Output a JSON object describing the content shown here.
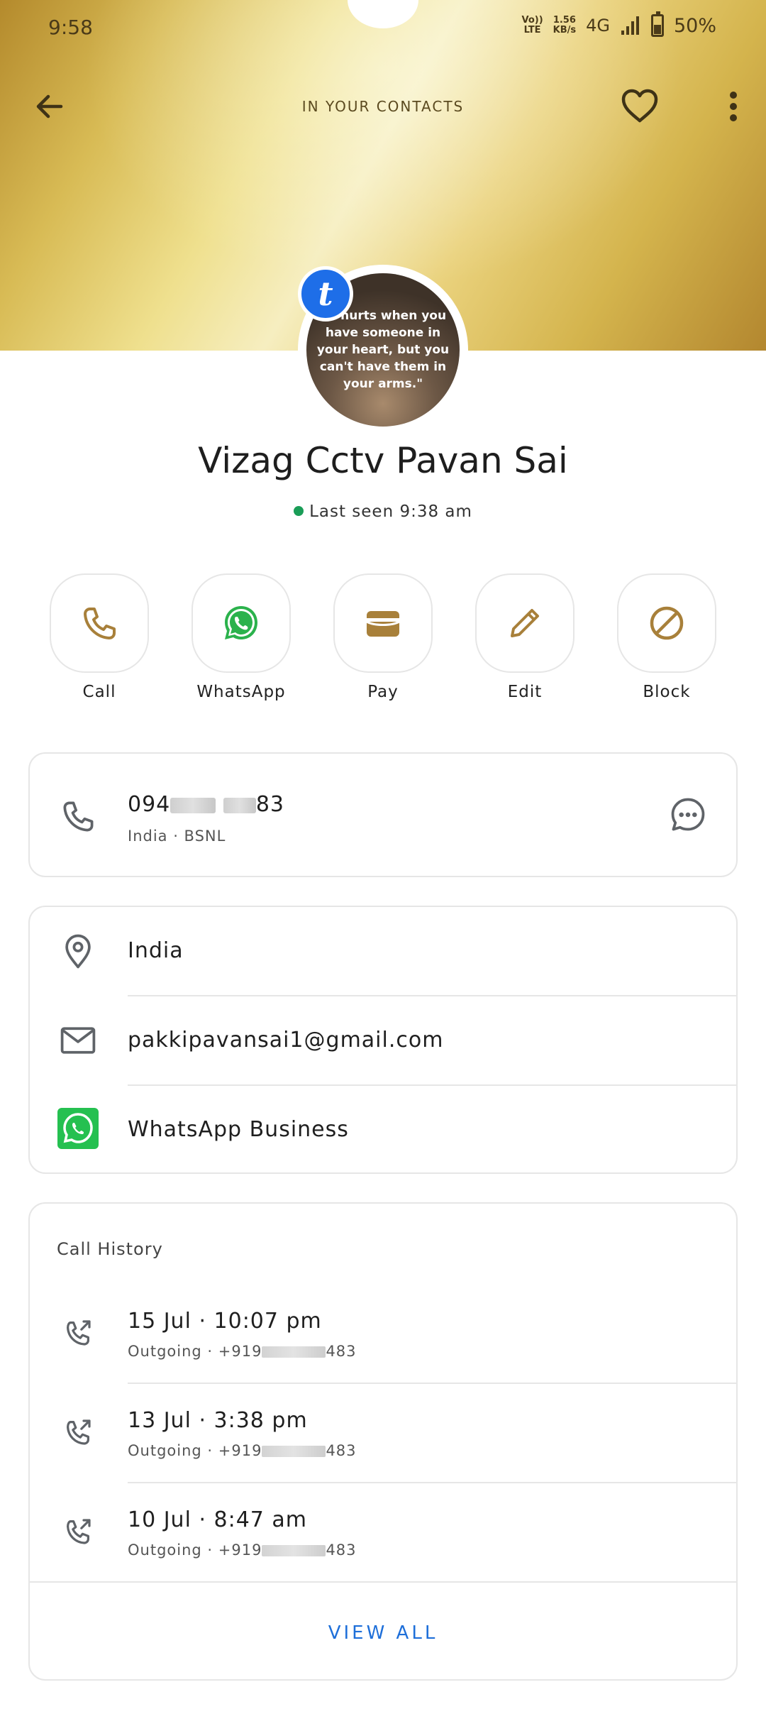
{
  "status_bar": {
    "time": "9:58",
    "volte_top": "Vo))",
    "volte_bottom": "LTE",
    "speed_top": "1.56",
    "speed_bottom": "KB/s",
    "network": "4G",
    "battery_percent": "50%",
    "battery_level": 0.5
  },
  "topbar": {
    "title": "IN YOUR CONTACTS"
  },
  "profile": {
    "avatar_badge": "t",
    "avatar_quote": "\"It hurts when you have someone in your heart, but you can't have them in your arms.\"",
    "name": "Vizag Cctv Pavan Sai",
    "last_seen": "Last seen 9:38 am",
    "online_color": "#1a9d57"
  },
  "actions": [
    {
      "label": "Call",
      "icon": "phone-icon"
    },
    {
      "label": "WhatsApp",
      "icon": "whatsapp-icon"
    },
    {
      "label": "Pay",
      "icon": "wallet-icon"
    },
    {
      "label": "Edit",
      "icon": "pencil-icon"
    },
    {
      "label": "Block",
      "icon": "block-icon"
    }
  ],
  "phone": {
    "number_prefix": "094",
    "number_suffix": "83",
    "carrier": "India · BSNL"
  },
  "details": {
    "location": "India",
    "email": "pakkipavansai1@gmail.com",
    "whatsapp": "WhatsApp Business"
  },
  "call_history": {
    "title": "Call History",
    "items": [
      {
        "datetime": "15 Jul · 10:07 pm",
        "detail_prefix": "Outgoing · +919",
        "detail_suffix": "483"
      },
      {
        "datetime": "13 Jul · 3:38 pm",
        "detail_prefix": "Outgoing · +919",
        "detail_suffix": "483"
      },
      {
        "datetime": "10 Jul · 8:47 am",
        "detail_prefix": "Outgoing · +919",
        "detail_suffix": "483"
      }
    ],
    "view_all": "VIEW ALL"
  },
  "colors": {
    "accent_gold": "#a8803a",
    "link_blue": "#1e6fd9",
    "whatsapp_green": "#25c050",
    "icon_gray": "#5f6368"
  }
}
